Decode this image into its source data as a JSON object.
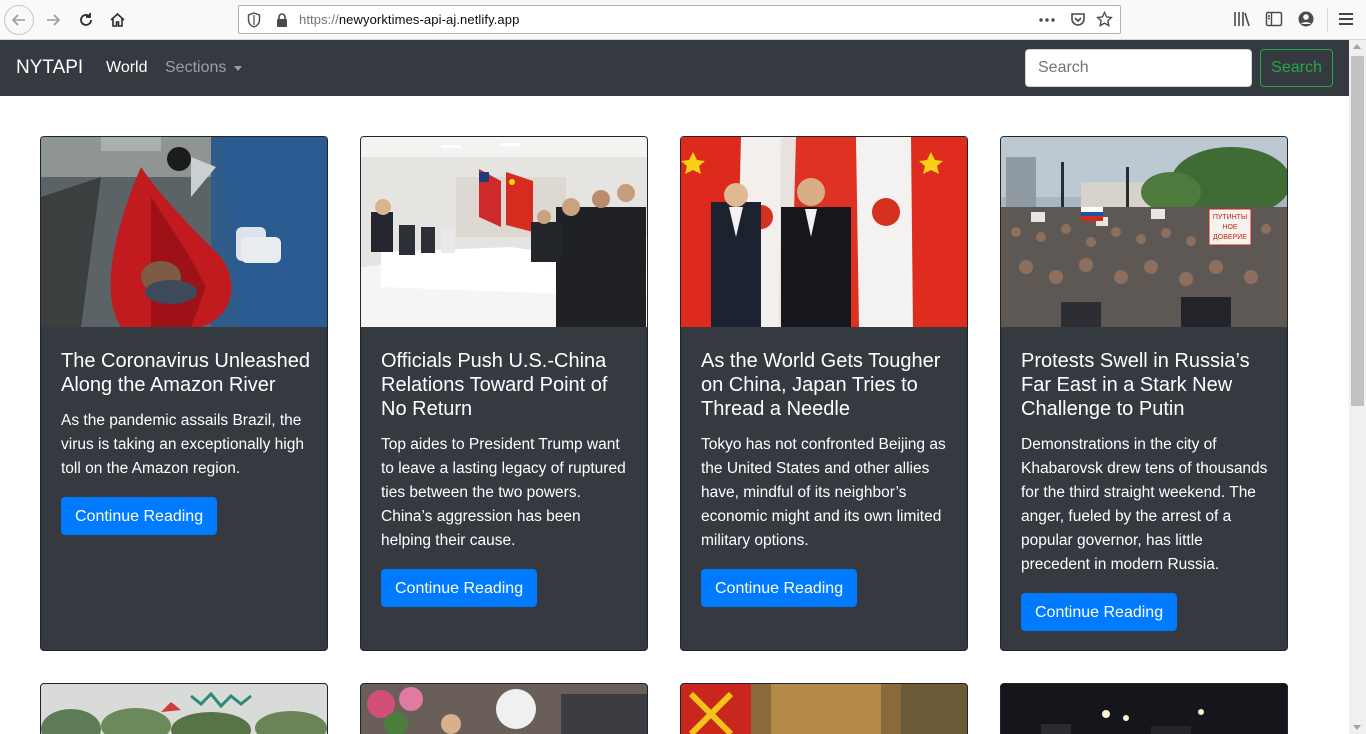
{
  "browser": {
    "url_scheme": "https://",
    "url_host": "newyorktimes-api-aj.netlify.app"
  },
  "navbar": {
    "brand": "NYTAPI",
    "links": [
      "World",
      "Sections"
    ],
    "search_placeholder": "Search",
    "search_button": "Search"
  },
  "articles": [
    {
      "title": "The Coronavirus Unleashed Along the Amazon River",
      "abstract": "As the pandemic assails Brazil, the virus is taking an exceptionally high toll on the Amazon region.",
      "button": "Continue Reading"
    },
    {
      "title": "Officials Push U.S.-China Relations Toward Point of No Return",
      "abstract": "Top aides to President Trump want to leave a lasting legacy of ruptured ties between the two powers. China’s aggression has been helping their cause.",
      "button": "Continue Reading"
    },
    {
      "title": "As the World Gets Tougher on China, Japan Tries to Thread a Needle",
      "abstract": "Tokyo has not confronted Beijing as the United States and other allies have, mindful of its neighbor’s economic might and its own limited military options.",
      "button": "Continue Reading"
    },
    {
      "title": "Protests Swell in Russia’s Far East in a Stark New Challenge to Putin",
      "abstract": "Demonstrations in the city of Khabarovsk drew tens of thousands for the third straight weekend. The anger, fueled by the arrest of a popular governor, has little precedent in modern Russia.",
      "button": "Continue Reading"
    }
  ],
  "photo_signs": [
    "ПУТИНТЫ",
    "НОЕ",
    "ДОВЕРИЕ"
  ],
  "colors": {
    "navbar": "#343a40",
    "card": "#343a40",
    "primary": "#007bff",
    "success": "#28a745"
  }
}
